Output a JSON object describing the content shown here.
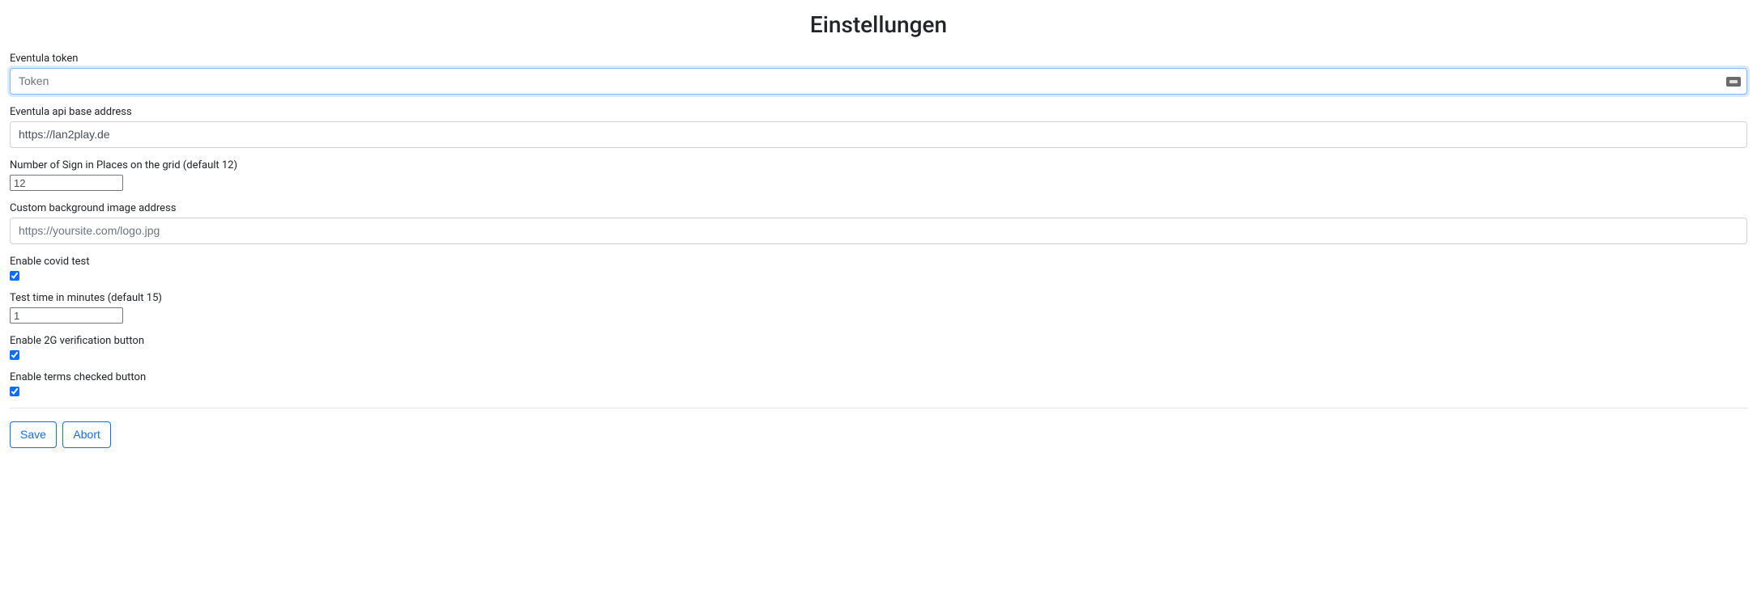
{
  "page": {
    "title": "Einstellungen"
  },
  "fields": {
    "eventula_token": {
      "label": "Eventula token",
      "placeholder": "Token",
      "value": ""
    },
    "api_base": {
      "label": "Eventula api base address",
      "value": "https://lan2play.de"
    },
    "signin_places": {
      "label": "Number of Sign in Places on the grid (default 12)",
      "value": "12"
    },
    "bg_image": {
      "label": "Custom background image address",
      "placeholder": "https://yoursite.com/logo.jpg",
      "value": ""
    },
    "covid_test": {
      "label": "Enable covid test",
      "checked": true
    },
    "test_time": {
      "label": "Test time in minutes (default 15)",
      "value": "1"
    },
    "enable_2g": {
      "label": "Enable 2G verification button",
      "checked": true
    },
    "enable_terms": {
      "label": "Enable terms checked button",
      "checked": true
    }
  },
  "buttons": {
    "save": "Save",
    "abort": "Abort"
  }
}
